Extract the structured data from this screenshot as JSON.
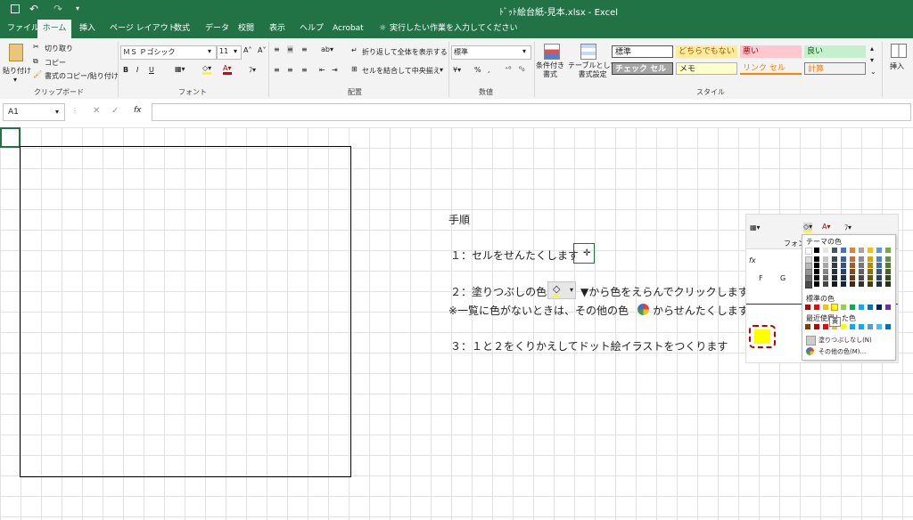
{
  "titlebar": {
    "filename": "ﾄﾞｯﾄ絵台紙-見本.xlsx  -  Excel"
  },
  "tabs": [
    "ファイル",
    "ホーム",
    "挿入",
    "ページ レイアウト",
    "数式",
    "データ",
    "校閲",
    "表示",
    "ヘルプ",
    "Acrobat"
  ],
  "tellme": "実行したい作業を入力してください",
  "ribbon": {
    "clipboard": {
      "paste": "貼り付け",
      "cut": "切り取り",
      "copy": "コピー",
      "format_painter": "書式のコピー/貼り付け",
      "label": "クリップボード"
    },
    "font": {
      "name": "ＭＳ Ｐゴシック",
      "size": "11",
      "label": "フォント"
    },
    "alignment": {
      "wrap": "折り返して全体を表示する",
      "merge": "セルを結合して中央揃え",
      "label": "配置"
    },
    "number": {
      "format": "標準",
      "label": "数値"
    },
    "styles": {
      "cond": "条件付き\n書式",
      "table": "テーブルとして\n書式設定",
      "cells": [
        "標準",
        "どちらでもない",
        "悪い",
        "良い",
        "チェック セル",
        "メモ",
        "リンク セル",
        "計算"
      ],
      "label": "スタイル"
    },
    "insert": "挿入"
  },
  "namebox": "A1",
  "instructions": {
    "heading": "手順",
    "step1": "１：セルをせんたくします",
    "step2a": "２：塗りつぶしの色",
    "step2b": "▼から色をえらんでクリックします",
    "note_a": "※一覧に色がないときは、その他の色",
    "note_b": "からせんたくします",
    "step3": "３：１と２をくりかえしてドット絵イラストをつくります"
  },
  "popup": {
    "font_tab": "フォント",
    "theme_colors": "テーマの色",
    "standard_colors": "標準の色",
    "recent": "最近使用した色",
    "tooltip": "黄",
    "no_fill": "塗りつぶしなし(N)",
    "more_colors": "その他の色(M)...",
    "col_labels": [
      "F",
      "G"
    ]
  }
}
